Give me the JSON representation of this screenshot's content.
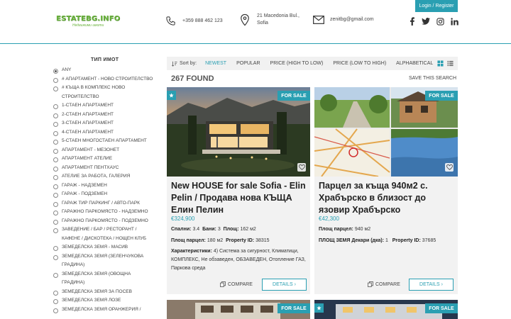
{
  "header": {
    "logo_main": "ESTATEBG.INFO",
    "logo_sub": "Недвижими имоти",
    "phone": "+359 888 462 123",
    "address_line1": "21 Macedonia Bul.,",
    "address_line2": "Sofia",
    "email": "zenitbg@gmail.com",
    "login_label": "Login / Register",
    "social_icons": [
      "facebook-icon",
      "twitter-icon",
      "instagram-icon",
      "linkedin-icon"
    ],
    "accent": "#2a9fb2"
  },
  "sidebar": {
    "title": "ТИП ИМОТ",
    "items": [
      {
        "label": "ANY",
        "checked": true
      },
      {
        "label": "# АПАРТАМЕНТ - НОВО СТРОИТЕЛСТВО",
        "checked": false
      },
      {
        "label": "# КЪЩА В КОМПЛЕКС НОВО",
        "label2": "СТРОИТЕЛСТВО",
        "checked": false
      },
      {
        "label": "1-СТАЕН АПАРТАМЕНТ",
        "checked": false
      },
      {
        "label": "2-СТАЕН АПАРТАМЕНТ",
        "checked": false
      },
      {
        "label": "3-СТАЕН АПАРТАМЕНТ",
        "checked": false
      },
      {
        "label": "4-СТАЕН АПАРТАМЕНТ",
        "checked": false
      },
      {
        "label": "5-СТАЕН МНОГОСТАЕН АПАРТАМЕНТ",
        "checked": false
      },
      {
        "label": "АПАРТАМЕНТ - МЕЗОНЕТ",
        "checked": false
      },
      {
        "label": "АПАРТАМЕНТ АТЕЛИЕ",
        "checked": false
      },
      {
        "label": "АПАРТАМЕНТ ПЕНТХАУС",
        "checked": false
      },
      {
        "label": "АТЕЛИЕ ЗА РАБОТА, ГАЛЕРИЯ",
        "checked": false
      },
      {
        "label": "ГАРАЖ - НАДЗЕМЕН",
        "checked": false
      },
      {
        "label": "ГАРАЖ - ПОДЗЕМЕН",
        "checked": false
      },
      {
        "label": "ГАРАЖ ТИР ПАРКИНГ / АВТО-ПАРК",
        "checked": false
      },
      {
        "label": "ГАРАЖНО ПАРКОМЯСТО - НАДЗЕМНО",
        "checked": false
      },
      {
        "label": "ГАРАЖНО ПАРКОМЯСТО - ПОДЗЕМНО",
        "checked": false
      },
      {
        "label": "ЗАВЕДЕНИЕ / БАР / РЕСТОРАНТ /",
        "label2": "КАФЕНЕ / ДИСКОТЕКА / НОЩЕН КЛУБ",
        "checked": false
      },
      {
        "label": "ЗЕМЕДЕЛСКА ЗЕМЯ - МАСИВ",
        "checked": false
      },
      {
        "label": "ЗЕМЕДЕЛСКА ЗЕМЯ (ЗЕЛЕНЧУКОВА",
        "label2": "ГРАДИНА)",
        "checked": false
      },
      {
        "label": "ЗЕМЕДЕЛСКА ЗЕМЯ (ОВОЩНА",
        "label2": "ГРАДИНА)",
        "checked": false
      },
      {
        "label": "ЗЕМЕДЕЛСКА ЗЕМЯ ЗА ПОСЕВ",
        "checked": false
      },
      {
        "label": "ЗЕМЕДЕЛСКА ЗЕМЯ ЛОЗЕ",
        "checked": false
      },
      {
        "label": "ЗЕМЕДЕЛСКА ЗЕМЯ ОРАНЖЕРИЯ /",
        "checked": false
      }
    ]
  },
  "sortbar": {
    "sort_by": "Sort by:",
    "options": [
      "NEWEST",
      "POPULAR",
      "PRICE (HIGH TO LOW)",
      "PRICE (LOW TO HIGH)",
      "ALPHABETICAL"
    ],
    "active": "NEWEST"
  },
  "results": {
    "found": "267 FOUND",
    "save_search": "SAVE THIS SEARCH"
  },
  "cards": [
    {
      "badge": "FOR SALE",
      "title": "New HOUSE for sale  Sofia - Elin Pelin / Продава нова  КЪЩА Елин Пелин",
      "price": "€324,900",
      "row1": [
        {
          "k": "Спални:",
          "v": "3.4"
        },
        {
          "k": "Бани:",
          "v": "3"
        },
        {
          "k": "Площ:",
          "v": "162 м2"
        }
      ],
      "row2": [
        {
          "k": "Площ парцел:",
          "v": "180 м2"
        },
        {
          "k": "Property ID:",
          "v": "38315"
        }
      ],
      "features_key": "Характеристики:",
      "features_val": "4) Система за сигурност, Климатици, КОМПЛЕКС, Не обзаведен, ОБЗАВЕДЕН, Отопление ГАЗ, Паркова среда",
      "compare": "COMPARE",
      "details": "DETAILS"
    },
    {
      "badge": "FOR SALE",
      "title": "Парцел за къща 940м2 с. Храбърско в близост до язовир Храбърско",
      "price": "€42,300",
      "row1": [
        {
          "k": "Площ парцел:",
          "v": "940 м2"
        }
      ],
      "row2": [
        {
          "k": "ПЛОЩ ЗЕМЯ Декари (дка):",
          "v": "1"
        },
        {
          "k": "Property ID:",
          "v": "37685"
        }
      ],
      "compare": "COMPARE",
      "details": "DETAILS"
    }
  ],
  "bottom_cards": [
    {
      "badge": "FOR SALE"
    },
    {
      "badge": "FOR SALE"
    }
  ]
}
